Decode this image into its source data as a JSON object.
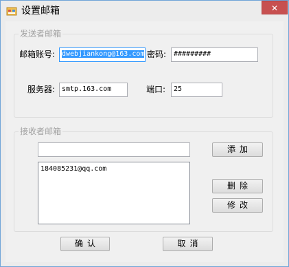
{
  "window": {
    "title": "设置邮箱",
    "close_glyph": "✕"
  },
  "sender": {
    "group_label": "发送者邮箱",
    "account_label": "邮箱账号:",
    "account_value": "dwebjiankong@163.com",
    "password_label": "密码:",
    "password_value": "#########",
    "server_label": "服务器:",
    "server_value": "smtp.163.com",
    "port_label": "端口:",
    "port_value": "25"
  },
  "receiver": {
    "group_label": "接收者邮箱",
    "input_value": "",
    "list_items": [
      "184085231@qq.com"
    ],
    "add_label": "添加",
    "delete_label": "删除",
    "edit_label": "修改"
  },
  "footer": {
    "ok_label": "确认",
    "cancel_label": "取消"
  },
  "colors": {
    "accent": "#3399ff",
    "close": "#c75050",
    "group_text": "#a3a3a3"
  },
  "icons": {
    "title_icon": "app-window-icon",
    "close_icon": "close-icon"
  }
}
